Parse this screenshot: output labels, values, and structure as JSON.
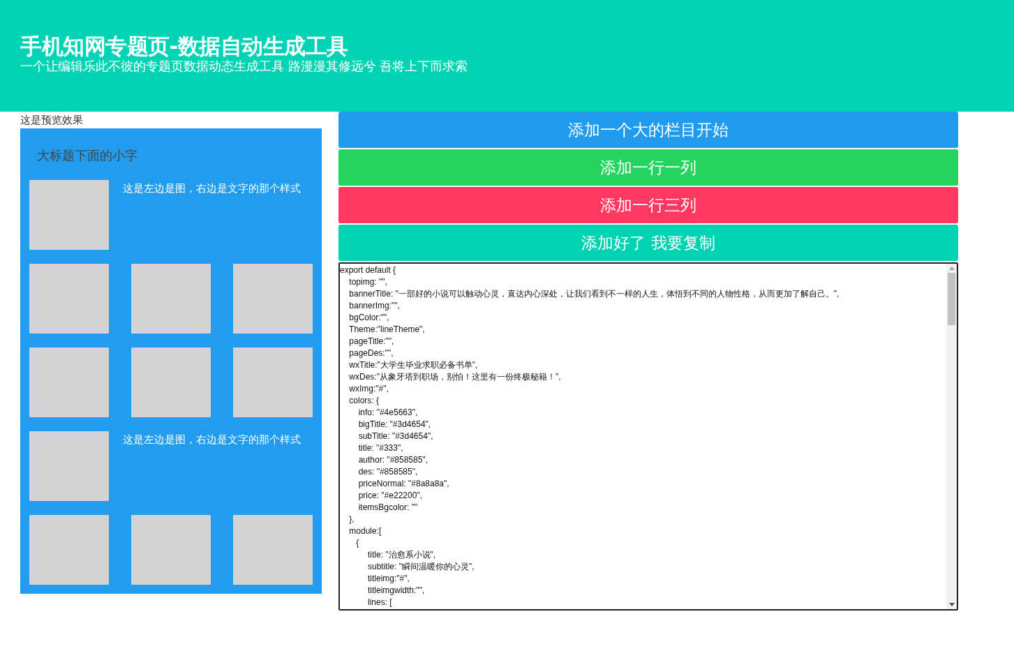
{
  "header": {
    "title": "手机知网专题页-数据自动生成工具",
    "subtitle": "一个让编辑乐此不彼的专题页数据动态生成工具 路漫漫其修远兮 吾将上下而求索"
  },
  "preview": {
    "label": "这是预览效果",
    "heading": "大标题下面的小字",
    "modules": [
      {
        "kind": "image-text",
        "text": "这是左边是图，右边是文字的那个样式"
      },
      {
        "kind": "three-images"
      },
      {
        "kind": "three-images"
      },
      {
        "kind": "image-text",
        "text": "这是左边是图，右边是文字的那个样式"
      },
      {
        "kind": "three-images"
      }
    ]
  },
  "buttons": [
    {
      "label": "添加一个大的栏目开始",
      "color": "#219bee"
    },
    {
      "label": "添加一行一列",
      "color": "#25d45f"
    },
    {
      "label": "添加一行三列",
      "color": "#ff3861"
    },
    {
      "label": "添加好了 我要复制",
      "color": "#00d2b4"
    }
  ],
  "code_lines": [
    "export default {",
    "    topimg: \"\",",
    "    bannerTitle: \"一部好的小说可以触动心灵，直达内心深处，让我们看到不一样的人生，体悟到不同的人物性格，从而更加了解自己。\",",
    "    bannerImg:\"\",",
    "    bgColor:\"\",",
    "    Theme:\"lineTheme\",",
    "    pageTitle:\"\",",
    "    pageDes:\"\",",
    "    wxTitle:\"大学生毕业求职必备书单\",",
    "    wxDes:\"从象牙塔到职场，别怕！这里有一份终极秘籍！\",",
    "    wxImg:\"#\",",
    "    colors: {",
    "        info: \"#4e5663\",",
    "        bigTitle: \"#3d4654\",",
    "        subTitle: \"#3d4654\",",
    "        title: \"#333\",",
    "        author: \"#858585\",",
    "        des: \"#858585\",",
    "        priceNormal: \"#8a8a8a\",",
    "        price: \"#e22200\",",
    "        itemsBgcolor: \"\"",
    "    },",
    "    module:[",
    "       {",
    "            title: \"治愈系小说\",",
    "            subtitle: \"瞬间温暖你的心灵\",",
    "            titleimg:\"#\",",
    "            titleimgwidth:\"\",",
    "            lines: ["
  ]
}
